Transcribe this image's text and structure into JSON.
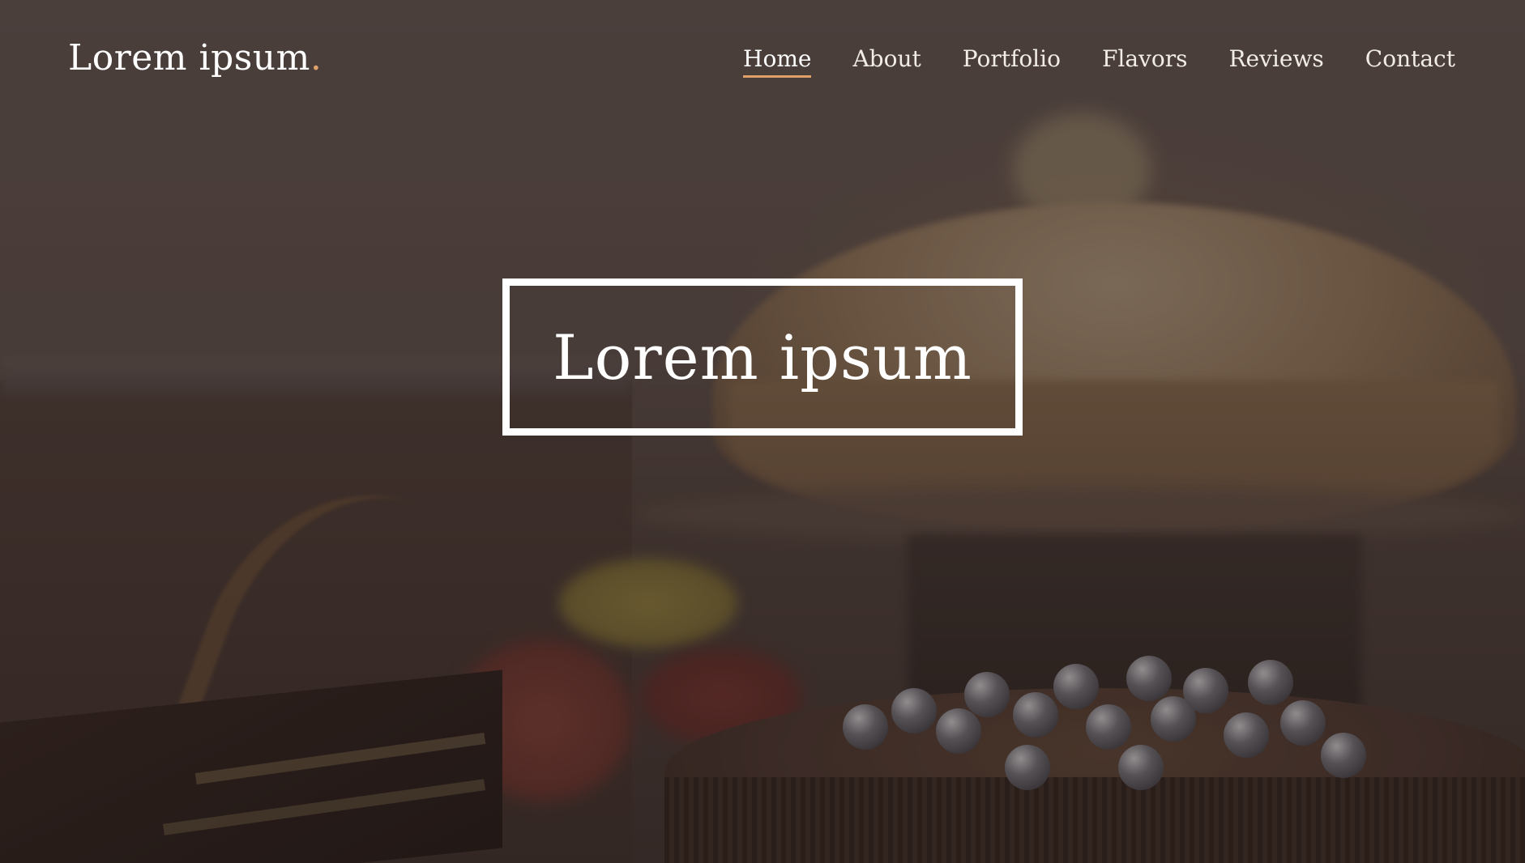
{
  "brand": {
    "name": "Lorem ipsum",
    "dot": ".",
    "accent_color": "#e0a06a"
  },
  "nav": {
    "items": [
      {
        "label": "Home",
        "active": true
      },
      {
        "label": "About",
        "active": false
      },
      {
        "label": "Portfolio",
        "active": false
      },
      {
        "label": "Flavors",
        "active": false
      },
      {
        "label": "Reviews",
        "active": false
      },
      {
        "label": "Contact",
        "active": false
      }
    ]
  },
  "hero": {
    "title": "Lorem ipsum"
  }
}
